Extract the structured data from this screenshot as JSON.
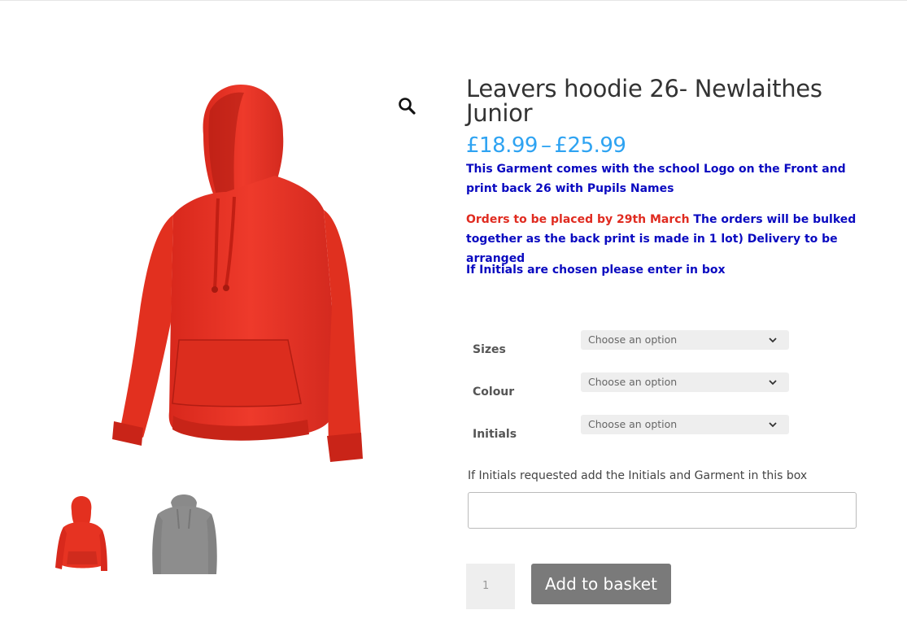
{
  "product": {
    "title": "Leavers hoodie 26- Newlaithes Junior",
    "price_low": "£18.99",
    "price_sep": "–",
    "price_high": "£25.99",
    "description_1": "This Garment comes with the school Logo on the Front and print back 26 with Pupils Names",
    "description_2_red": "Orders to be placed by 29th March",
    "description_2_rest": " The orders will be bulked together as the back print is made in 1 lot) Delivery to be arranged",
    "description_3": "If Initials are chosen please enter in box"
  },
  "gallery": {
    "main_image": "red-hoodie",
    "zoom_icon": "magnifier-icon",
    "thumbnails": [
      "red-hoodie",
      "grey-hoodie"
    ]
  },
  "variations": [
    {
      "label": "Sizes",
      "placeholder": "Choose an option"
    },
    {
      "label": "Colour",
      "placeholder": "Choose an option"
    },
    {
      "label": "Initials",
      "placeholder": "Choose an option"
    }
  ],
  "initials_field": {
    "label": "If Initials requested add the Initials and Garment in this box",
    "value": ""
  },
  "cart": {
    "quantity": "1",
    "add_label": "Add to basket"
  },
  "colors": {
    "accent": "#2ea3f2",
    "description_blue": "#0a0ac0",
    "description_red": "#e02b20",
    "button": "#7a7a7a"
  }
}
